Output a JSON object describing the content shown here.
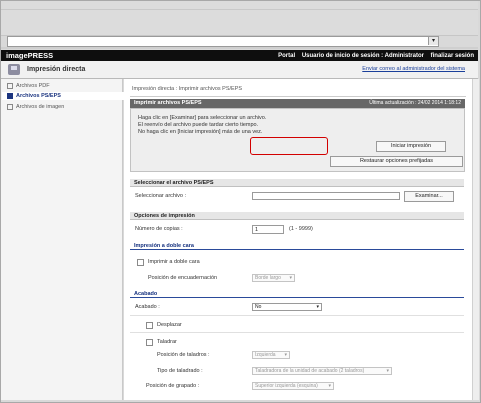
{
  "header": {
    "brand": "imagePRESS",
    "links": [
      "Portal",
      "Usuario de inicio de sesión : Administrator",
      "finalizar sesión"
    ]
  },
  "titlebar": {
    "title": "Impresión directa",
    "admin_link": "Enviar correo al administrador del sistema"
  },
  "sidebar": {
    "items": [
      {
        "label": "Archivos PDF"
      },
      {
        "label": "Archivos PS/EPS"
      },
      {
        "label": "Archivos de imagen"
      }
    ]
  },
  "main": {
    "breadcrumb": "Impresión directa : Imprimir archivos PS/EPS",
    "heading": "Imprimir archivos PS/EPS",
    "last_update": "Última actualización : 24/02 2014 1:18:12",
    "messages": [
      "Haga clic en [Examinar] para seleccionar un archivo.",
      "El reenvío del archivo puede tardar cierto tiempo.",
      "No haga clic en [Iniciar impresión] más de una vez."
    ],
    "start_button": "Iniciar impresión",
    "reset_button": "Restaurar opciones prefijadas"
  },
  "file_section": {
    "title": "Seleccionar el archivo PS/EPS",
    "label": "Seleccionar archivo :",
    "browse_button": "Examinar..."
  },
  "print_options": {
    "title": "Opciones de impresión",
    "copies_label": "Número de copias :",
    "copies_value": "1",
    "copies_range": "(1 - 9999)"
  },
  "duplex": {
    "title": "Impresión a doble cara",
    "checkbox_label": "Imprimir a doble cara",
    "binding_label": "Posición de encuadernación",
    "binding_value": "Borde largo"
  },
  "finishing": {
    "title": "Acabado",
    "label": "Acabado :",
    "value": "No",
    "offset_label": "Desplazar",
    "punch_label": "Taladrar",
    "punch_pos_label": "Posición de taladros :",
    "punch_pos_value": "Izquierda",
    "punch_type_label": "Tipo de taladrado :",
    "punch_type_value": "Taladradora de la unidad de acabado (2 taladros)",
    "staple_label": "Posición de grapado :",
    "staple_value": "Superior izquierda (esquina)"
  },
  "colors": {
    "highlight": "#d20000",
    "link": "#1a3f9a",
    "header_bg": "#0e0e0e"
  }
}
